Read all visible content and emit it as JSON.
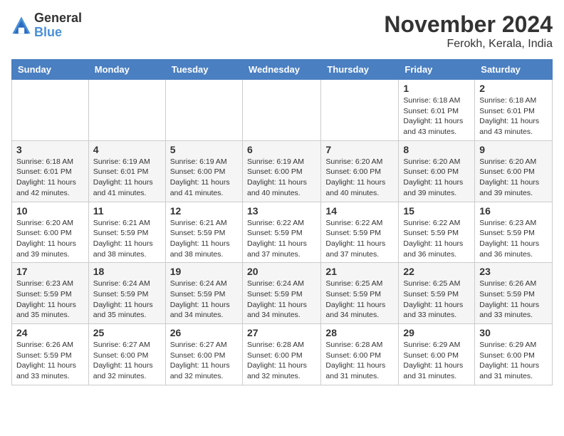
{
  "logo": {
    "general": "General",
    "blue": "Blue"
  },
  "header": {
    "month": "November 2024",
    "location": "Ferokh, Kerala, India"
  },
  "weekdays": [
    "Sunday",
    "Monday",
    "Tuesday",
    "Wednesday",
    "Thursday",
    "Friday",
    "Saturday"
  ],
  "weeks": [
    [
      {
        "day": "",
        "info": ""
      },
      {
        "day": "",
        "info": ""
      },
      {
        "day": "",
        "info": ""
      },
      {
        "day": "",
        "info": ""
      },
      {
        "day": "",
        "info": ""
      },
      {
        "day": "1",
        "info": "Sunrise: 6:18 AM\nSunset: 6:01 PM\nDaylight: 11 hours and 43 minutes."
      },
      {
        "day": "2",
        "info": "Sunrise: 6:18 AM\nSunset: 6:01 PM\nDaylight: 11 hours and 43 minutes."
      }
    ],
    [
      {
        "day": "3",
        "info": "Sunrise: 6:18 AM\nSunset: 6:01 PM\nDaylight: 11 hours and 42 minutes."
      },
      {
        "day": "4",
        "info": "Sunrise: 6:19 AM\nSunset: 6:01 PM\nDaylight: 11 hours and 41 minutes."
      },
      {
        "day": "5",
        "info": "Sunrise: 6:19 AM\nSunset: 6:00 PM\nDaylight: 11 hours and 41 minutes."
      },
      {
        "day": "6",
        "info": "Sunrise: 6:19 AM\nSunset: 6:00 PM\nDaylight: 11 hours and 40 minutes."
      },
      {
        "day": "7",
        "info": "Sunrise: 6:20 AM\nSunset: 6:00 PM\nDaylight: 11 hours and 40 minutes."
      },
      {
        "day": "8",
        "info": "Sunrise: 6:20 AM\nSunset: 6:00 PM\nDaylight: 11 hours and 39 minutes."
      },
      {
        "day": "9",
        "info": "Sunrise: 6:20 AM\nSunset: 6:00 PM\nDaylight: 11 hours and 39 minutes."
      }
    ],
    [
      {
        "day": "10",
        "info": "Sunrise: 6:20 AM\nSunset: 6:00 PM\nDaylight: 11 hours and 39 minutes."
      },
      {
        "day": "11",
        "info": "Sunrise: 6:21 AM\nSunset: 5:59 PM\nDaylight: 11 hours and 38 minutes."
      },
      {
        "day": "12",
        "info": "Sunrise: 6:21 AM\nSunset: 5:59 PM\nDaylight: 11 hours and 38 minutes."
      },
      {
        "day": "13",
        "info": "Sunrise: 6:22 AM\nSunset: 5:59 PM\nDaylight: 11 hours and 37 minutes."
      },
      {
        "day": "14",
        "info": "Sunrise: 6:22 AM\nSunset: 5:59 PM\nDaylight: 11 hours and 37 minutes."
      },
      {
        "day": "15",
        "info": "Sunrise: 6:22 AM\nSunset: 5:59 PM\nDaylight: 11 hours and 36 minutes."
      },
      {
        "day": "16",
        "info": "Sunrise: 6:23 AM\nSunset: 5:59 PM\nDaylight: 11 hours and 36 minutes."
      }
    ],
    [
      {
        "day": "17",
        "info": "Sunrise: 6:23 AM\nSunset: 5:59 PM\nDaylight: 11 hours and 35 minutes."
      },
      {
        "day": "18",
        "info": "Sunrise: 6:24 AM\nSunset: 5:59 PM\nDaylight: 11 hours and 35 minutes."
      },
      {
        "day": "19",
        "info": "Sunrise: 6:24 AM\nSunset: 5:59 PM\nDaylight: 11 hours and 34 minutes."
      },
      {
        "day": "20",
        "info": "Sunrise: 6:24 AM\nSunset: 5:59 PM\nDaylight: 11 hours and 34 minutes."
      },
      {
        "day": "21",
        "info": "Sunrise: 6:25 AM\nSunset: 5:59 PM\nDaylight: 11 hours and 34 minutes."
      },
      {
        "day": "22",
        "info": "Sunrise: 6:25 AM\nSunset: 5:59 PM\nDaylight: 11 hours and 33 minutes."
      },
      {
        "day": "23",
        "info": "Sunrise: 6:26 AM\nSunset: 5:59 PM\nDaylight: 11 hours and 33 minutes."
      }
    ],
    [
      {
        "day": "24",
        "info": "Sunrise: 6:26 AM\nSunset: 5:59 PM\nDaylight: 11 hours and 33 minutes."
      },
      {
        "day": "25",
        "info": "Sunrise: 6:27 AM\nSunset: 6:00 PM\nDaylight: 11 hours and 32 minutes."
      },
      {
        "day": "26",
        "info": "Sunrise: 6:27 AM\nSunset: 6:00 PM\nDaylight: 11 hours and 32 minutes."
      },
      {
        "day": "27",
        "info": "Sunrise: 6:28 AM\nSunset: 6:00 PM\nDaylight: 11 hours and 32 minutes."
      },
      {
        "day": "28",
        "info": "Sunrise: 6:28 AM\nSunset: 6:00 PM\nDaylight: 11 hours and 31 minutes."
      },
      {
        "day": "29",
        "info": "Sunrise: 6:29 AM\nSunset: 6:00 PM\nDaylight: 11 hours and 31 minutes."
      },
      {
        "day": "30",
        "info": "Sunrise: 6:29 AM\nSunset: 6:00 PM\nDaylight: 11 hours and 31 minutes."
      }
    ]
  ]
}
